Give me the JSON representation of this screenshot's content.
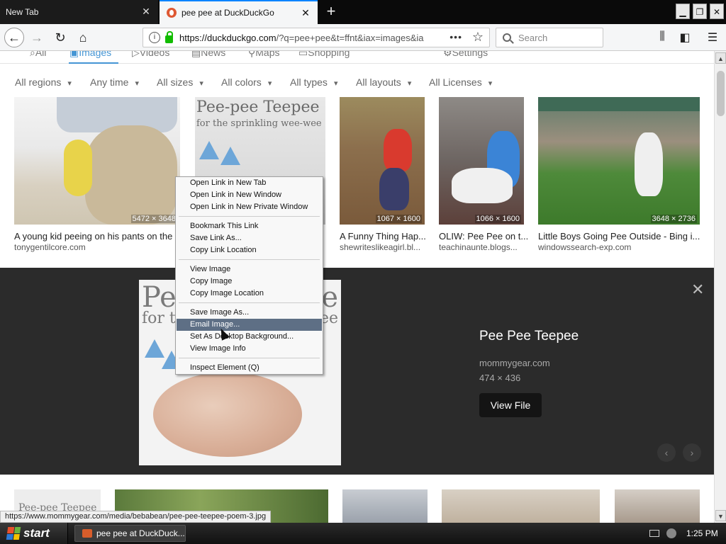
{
  "browser": {
    "tabs": [
      {
        "title": "New Tab",
        "active": false
      },
      {
        "title": "pee pee at DuckDuckGo",
        "active": true
      }
    ],
    "url_host": "https://duckduckgo.com",
    "url_path": "/?q=pee+pee&t=ffnt&iax=images&ia",
    "search_placeholder": "Search",
    "url_more": "•••",
    "status_url": "https://www.mommygear.com/media/bebabean/pee-pee-teepee-poem-3.jpg"
  },
  "ddg": {
    "nav": [
      {
        "label": "All",
        "active": false
      },
      {
        "label": "Images",
        "active": true
      },
      {
        "label": "Videos",
        "active": false
      },
      {
        "label": "News",
        "active": false
      },
      {
        "label": "Maps",
        "active": false
      },
      {
        "label": "Shopping",
        "active": false
      },
      {
        "label": "Settings",
        "active": false
      }
    ],
    "filters": [
      "All regions",
      "Any time",
      "All sizes",
      "All colors",
      "All types",
      "All layouts",
      "All Licenses"
    ],
    "results": [
      {
        "caption": "A young kid peeing on his pants on the ...",
        "source": "tonygentilcore.com",
        "dims": "5472 × 3648"
      },
      {
        "caption": "",
        "source": "",
        "dims": "",
        "img_text": "Pee-pee Teepee",
        "img_sub": "for the sprinkling wee-wee"
      },
      {
        "caption": "A Funny Thing Hap...",
        "source": "shewriteslikeagirl.bl...",
        "dims": "1067 × 1600"
      },
      {
        "caption": "OLIW: Pee Pee on t...",
        "source": "teachinaunte.blogs...",
        "dims": "1066 × 1600"
      },
      {
        "caption": "Little Boys Going Pee Outside - Bing i...",
        "source": "windowssearch-exp.com",
        "dims": "3648 × 2736"
      }
    ],
    "detail": {
      "title": "Pee Pee Teepee",
      "source": "mommygear.com",
      "dims": "474 × 436",
      "button": "View File",
      "img_text_left": "Pee",
      "img_sub_left": "for t",
      "img_text_right": "ee",
      "img_sub_right": "ee"
    },
    "bottom_first_text": "Pee-pee Teepee"
  },
  "context_menu": [
    {
      "label": "Open Link in New Tab",
      "highlighted": false
    },
    {
      "label": "Open Link in New Window",
      "highlighted": false
    },
    {
      "label": "Open Link in New Private Window",
      "highlighted": false
    },
    {
      "label": "Bookmark This Link",
      "highlighted": false
    },
    {
      "label": "Save Link As...",
      "highlighted": false
    },
    {
      "label": "Copy Link Location",
      "highlighted": false
    },
    {
      "label": "View Image",
      "highlighted": false
    },
    {
      "label": "Copy Image",
      "highlighted": false
    },
    {
      "label": "Copy Image Location",
      "highlighted": false
    },
    {
      "label": "Save Image As...",
      "highlighted": false
    },
    {
      "label": "Email Image...",
      "highlighted": true
    },
    {
      "label": "Set As Desktop Background...",
      "highlighted": false
    },
    {
      "label": "View Image Info",
      "highlighted": false
    },
    {
      "label": "Inspect Element (Q)",
      "highlighted": false
    }
  ],
  "taskbar": {
    "start_label": "start",
    "task_item": "pee pee at DuckDuck...",
    "clock": "1:25 PM"
  },
  "colors": {
    "accent": "#4495d4",
    "menu_highlight": "#5e6f85",
    "detail_bg": "#2b2b2b",
    "lock_green": "#12bc00"
  }
}
